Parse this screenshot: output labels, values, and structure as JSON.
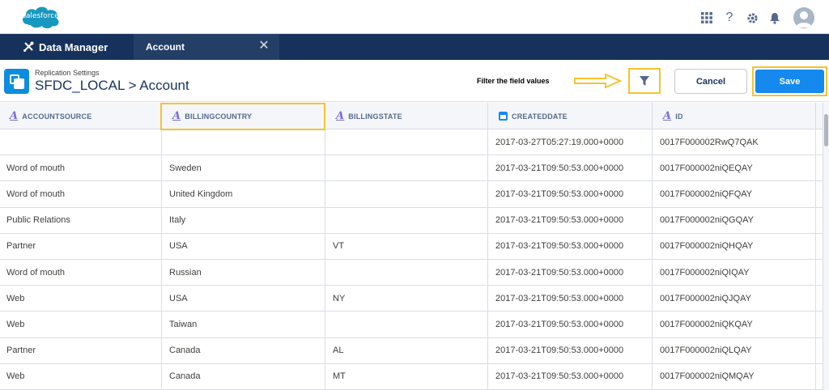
{
  "brand": {
    "logo_text": "salesforce"
  },
  "header_icons": [
    "apps-grid-icon",
    "help-icon",
    "gear-icon",
    "bell-icon",
    "avatar"
  ],
  "tabs": {
    "app_label": "Data Manager",
    "active_label": "Account"
  },
  "page": {
    "subtitle": "Replication Settings",
    "title": "SFDC_LOCAL > Account",
    "hint": "Filter the field values",
    "cancel_label": "Cancel",
    "save_label": "Save"
  },
  "grid": {
    "columns": [
      {
        "label": "ACCOUNTSOURCE",
        "type": "text"
      },
      {
        "label": "BILLINGCOUNTRY",
        "type": "text"
      },
      {
        "label": "BILLINGSTATE",
        "type": "text"
      },
      {
        "label": "CREATEDDATE",
        "type": "date"
      },
      {
        "label": "ID",
        "type": "text"
      }
    ],
    "rows": [
      [
        "",
        "",
        "",
        "2017-03-27T05:27:19.000+0000",
        "0017F000002RwQ7QAK"
      ],
      [
        "Word of mouth",
        "Sweden",
        "",
        "2017-03-21T09:50:53.000+0000",
        "0017F000002niQEQAY"
      ],
      [
        "Word of mouth",
        "United Kingdom",
        "",
        "2017-03-21T09:50:53.000+0000",
        "0017F000002niQFQAY"
      ],
      [
        "Public Relations",
        "Italy",
        "",
        "2017-03-21T09:50:53.000+0000",
        "0017F000002niQGQAY"
      ],
      [
        "Partner",
        "USA",
        "VT",
        "2017-03-21T09:50:53.000+0000",
        "0017F000002niQHQAY"
      ],
      [
        "Word of mouth",
        "Russian",
        "",
        "2017-03-21T09:50:53.000+0000",
        "0017F000002niQIQAY"
      ],
      [
        "Web",
        "USA",
        "NY",
        "2017-03-21T09:50:53.000+0000",
        "0017F000002niQJQAY"
      ],
      [
        "Web",
        "Taiwan",
        "",
        "2017-03-21T09:50:53.000+0000",
        "0017F000002niQKQAY"
      ],
      [
        "Partner",
        "Canada",
        "AL",
        "2017-03-21T09:50:53.000+0000",
        "0017F000002niQLQAY"
      ],
      [
        "Web",
        "Canada",
        "MT",
        "2017-03-21T09:50:53.000+0000",
        "0017F000002niQMQAY"
      ]
    ]
  },
  "colors": {
    "brand_blue": "#1589ee",
    "highlight": "#f4c430",
    "nav_dark": "#16325c"
  }
}
